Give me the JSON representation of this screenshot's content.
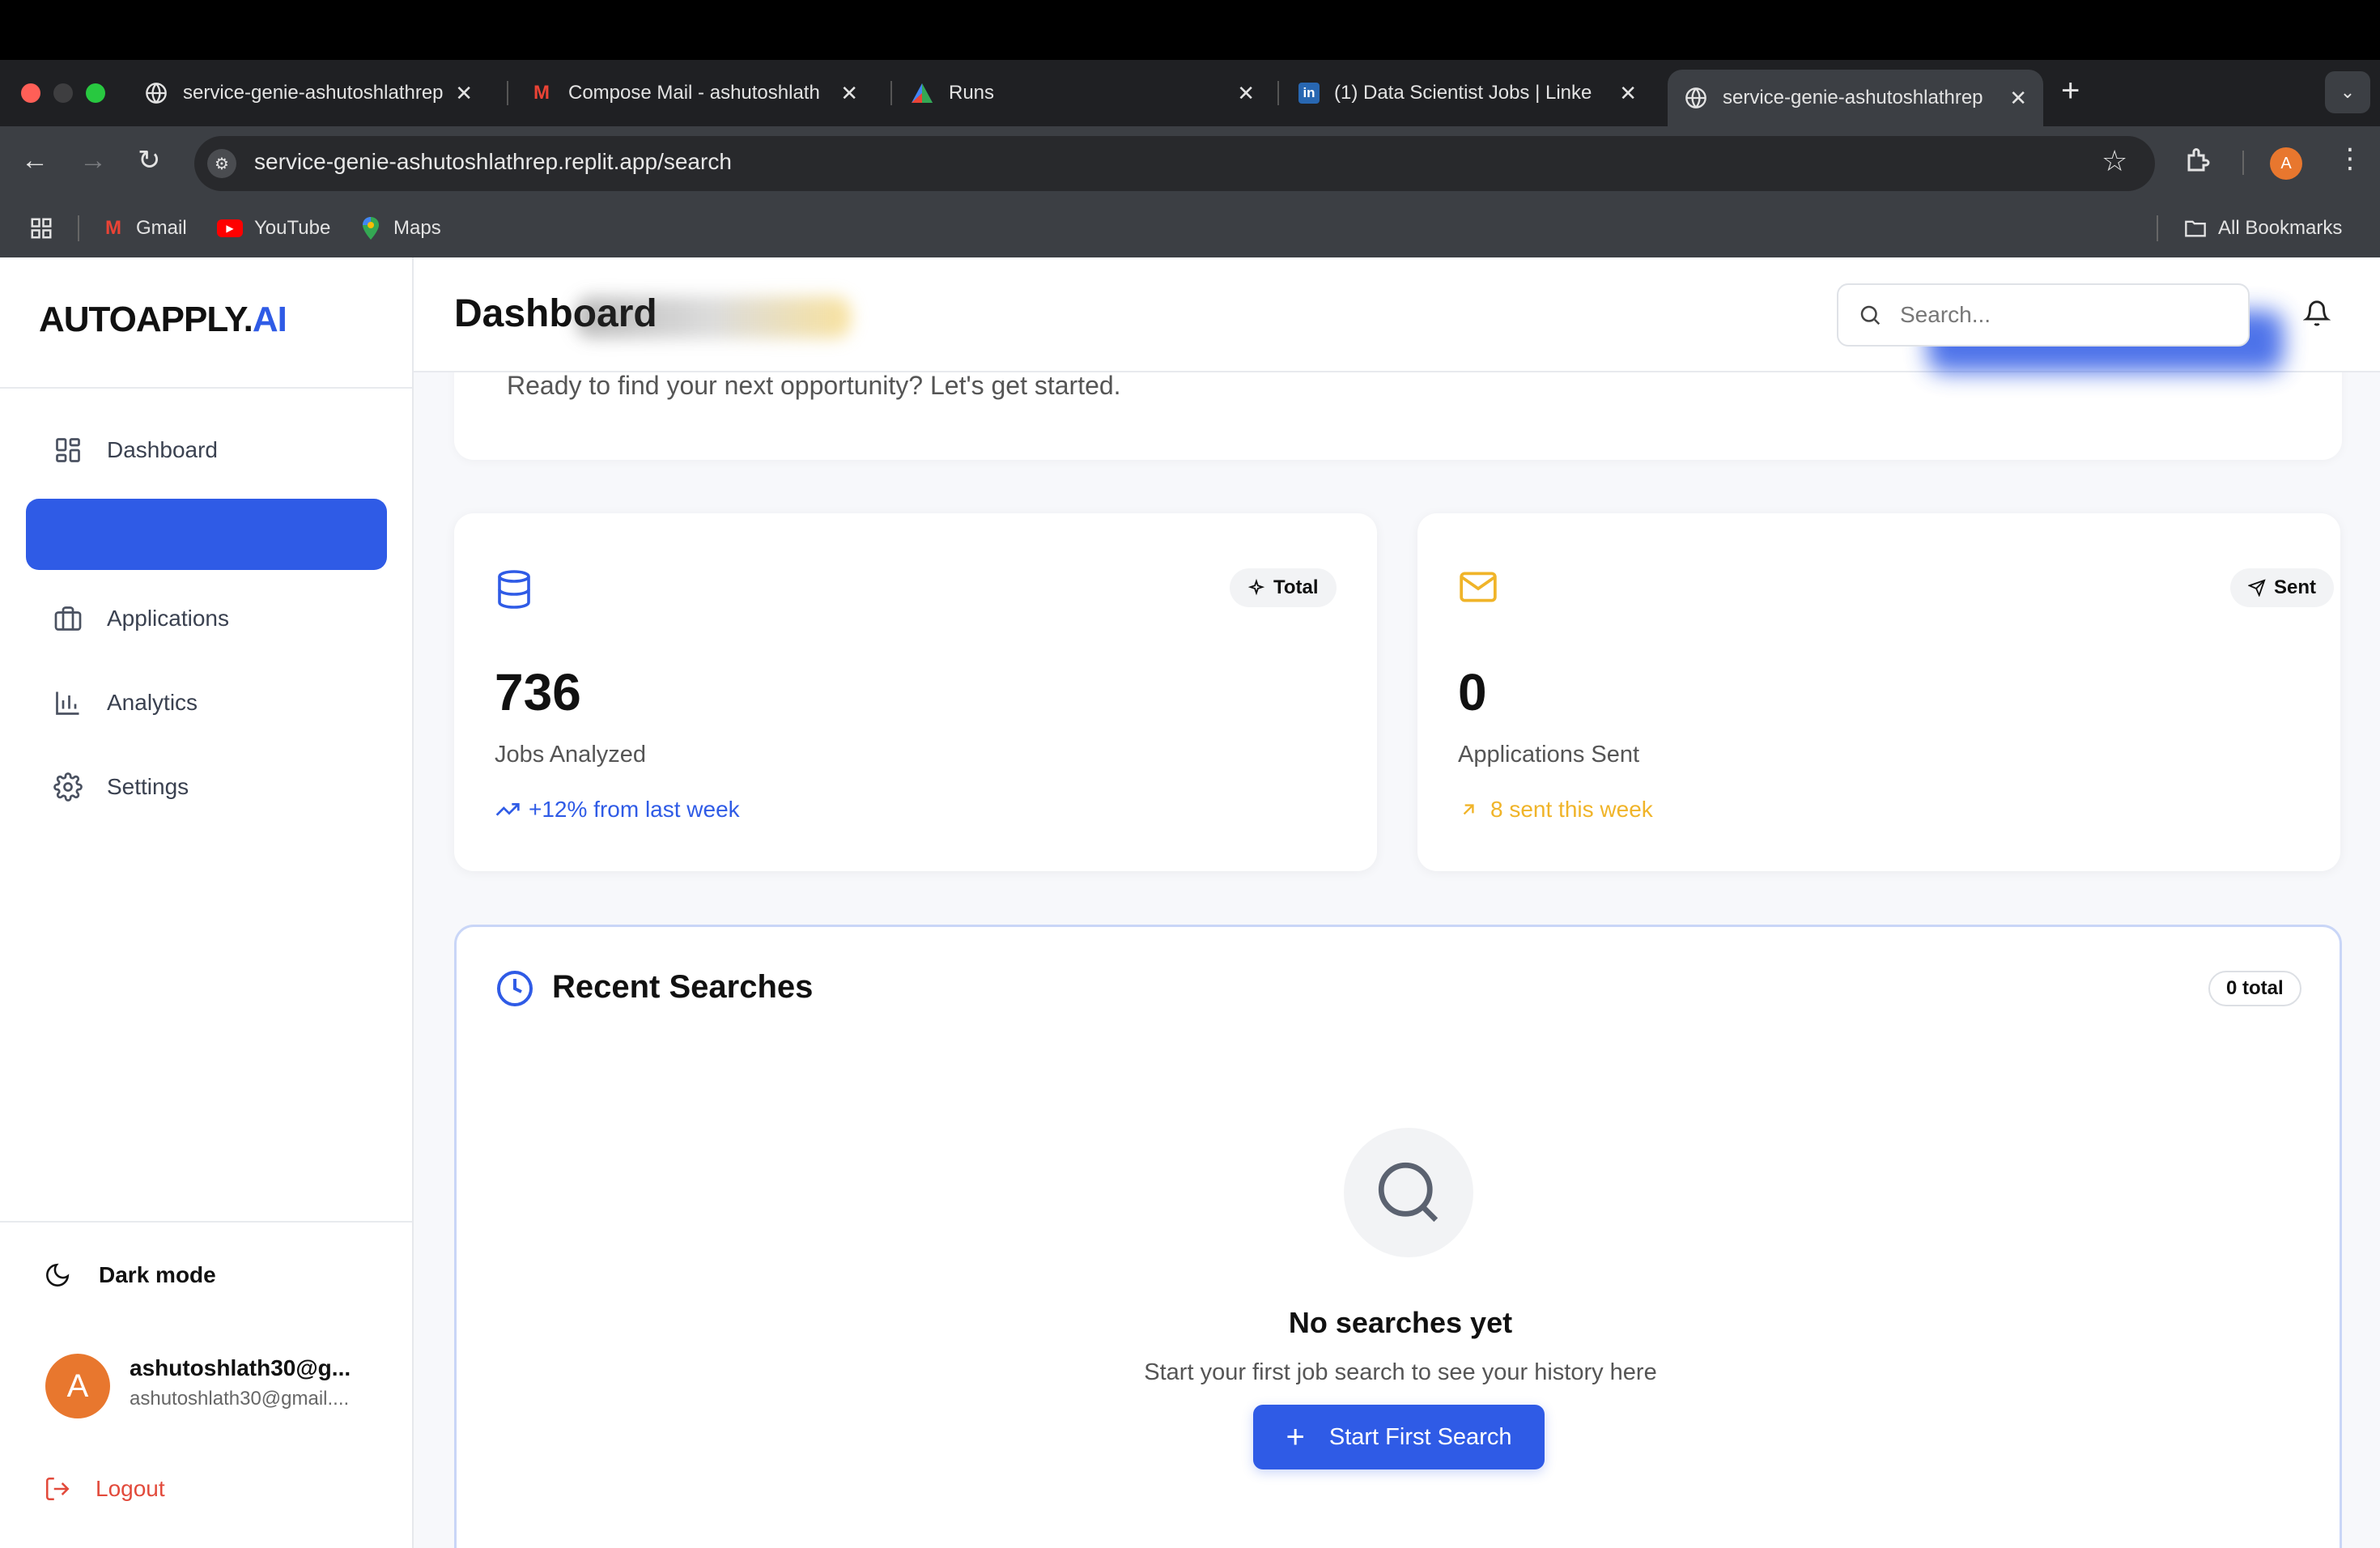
{
  "browser": {
    "tabs": [
      {
        "title": "service-genie-ashutoshlathrep",
        "icon": "globe-icon"
      },
      {
        "title": "Compose Mail - ashutoshlath",
        "icon": "gmail-icon"
      },
      {
        "title": "Runs",
        "icon": "triangle-logo-icon"
      },
      {
        "title": "(1) Data Scientist Jobs | Linke",
        "icon": "linkedin-icon"
      },
      {
        "title": "service-genie-ashutoshlathrep",
        "icon": "globe-icon"
      }
    ],
    "url": "service-genie-ashutoshlathrep.replit.app/search",
    "profile_initial": "A",
    "bookmarks": [
      {
        "label": "Gmail"
      },
      {
        "label": "YouTube"
      },
      {
        "label": "Maps"
      }
    ],
    "all_bookmarks": "All Bookmarks"
  },
  "sidebar": {
    "brand_main": "AUTOAPPLY.",
    "brand_accent": "AI",
    "items": [
      {
        "label": "Dashboard",
        "icon": "dashboard-grid-icon"
      },
      {
        "label": "",
        "icon": ""
      },
      {
        "label": "Applications",
        "icon": "briefcase-icon"
      },
      {
        "label": "Analytics",
        "icon": "bar-chart-icon"
      },
      {
        "label": "Settings",
        "icon": "gear-icon"
      }
    ],
    "dark_mode_label": "Dark mode",
    "user": {
      "initial": "A",
      "name": "ashutoshlath30@g...",
      "email": "ashutoshlath30@gmail...."
    },
    "logout_label": "Logout"
  },
  "header": {
    "title": "Dashboard",
    "search_placeholder": "Search..."
  },
  "welcome": {
    "subtitle": "Ready to find your next opportunity? Let's get started."
  },
  "stats": [
    {
      "pill": "Total",
      "value": "736",
      "label": "Jobs Analyzed",
      "trend": "+12% from last week",
      "color": "#2f5be6"
    },
    {
      "pill": "Sent",
      "value": "0",
      "label": "Applications Sent",
      "trend": "8 sent this week",
      "color": "#f0b429"
    }
  ],
  "recent_searches": {
    "title": "Recent Searches",
    "count_badge": "0 total",
    "empty_title": "No searches yet",
    "empty_subtitle": "Start your first job search to see your history here",
    "cta_label": "Start First Search"
  },
  "colors": {
    "accent": "#2f5be6",
    "warning": "#f0b429",
    "danger": "#e24a3b",
    "avatar": "#e8772e"
  }
}
